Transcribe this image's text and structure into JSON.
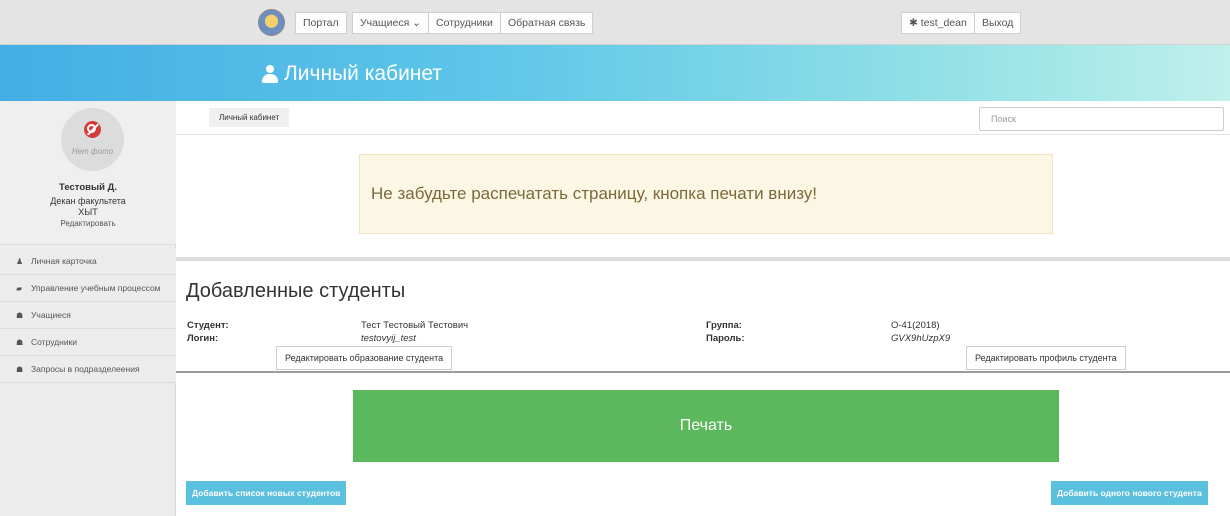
{
  "nav": {
    "links": [
      "Портал",
      "Учащиеся ⌄",
      "Сотрудники",
      "Обратная связь"
    ],
    "user": "✱ test_dean",
    "logout": "Выход"
  },
  "banner": {
    "title": "Личный кабинет"
  },
  "profile": {
    "no_photo": "Нет фото",
    "name": "Тестовый Д.",
    "position": "Декан факультета",
    "faculty": "ХЫТ",
    "edit": "Редактировать"
  },
  "sidebar": {
    "items": [
      {
        "icon": "user-icon",
        "glyph": "♟",
        "label": "Личная карточка"
      },
      {
        "icon": "graduation-cap-icon",
        "glyph": "▰",
        "label": "Управление учебным процессом"
      },
      {
        "icon": "users-icon",
        "glyph": "☗",
        "label": "Учащиеся"
      },
      {
        "icon": "users-icon",
        "glyph": "☗",
        "label": "Сотрудники"
      },
      {
        "icon": "users-icon",
        "glyph": "☗",
        "label": "Запросы в подразделеения"
      }
    ]
  },
  "breadcrumb": {
    "label": "Личный кабинет"
  },
  "search": {
    "placeholder": "Поиск",
    "value": ""
  },
  "alert": {
    "text": "Не забудьте распечатать страницу, кнопка печати внизу!"
  },
  "section": {
    "title": "Добавленные студенты"
  },
  "student": {
    "student_label": "Студент:",
    "student_value": "Тест Тестовый Тестович",
    "login_label": "Логин:",
    "login_value": "testovyij_test",
    "group_label": "Группа:",
    "group_value": "О-41(2018)",
    "password_label": "Пароль:",
    "password_value": "GVX9hUzpX9",
    "edit_education": "Редактировать образование студента",
    "edit_profile": "Редактировать профиль студента"
  },
  "print": {
    "label": "Печать"
  },
  "bottom": {
    "add_list": "Добавить список новых студентов",
    "add_one": "Добавить одного нового студента"
  },
  "colors": {
    "print_button": "#5cb85c",
    "info_button": "#5bc0de",
    "alert_bg": "#fcf7e5"
  }
}
